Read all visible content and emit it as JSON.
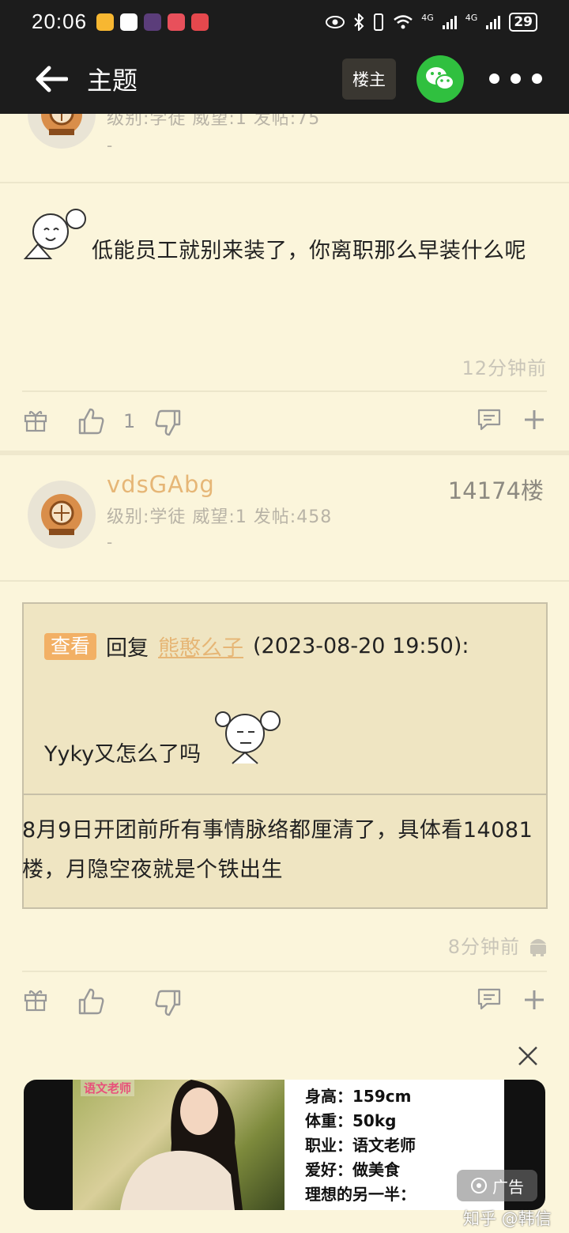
{
  "status_bar": {
    "time": "20:06",
    "signal_label_1": "4G",
    "signal_label_2": "4G",
    "battery": "29"
  },
  "title_bar": {
    "title": "主题",
    "author_only_label": "楼主"
  },
  "prev_post": {
    "meta": "级别:学徒 威望:1 发帖:75",
    "dash": "-",
    "text": "低能员工就别来装了，你离职那么早装什么呢",
    "time": "12分钟前",
    "like_count": "1"
  },
  "post": {
    "username": "vdsGAbg",
    "floor": "14174楼",
    "meta": "级别:学徒 威望:1 发帖:458",
    "dash": "-",
    "quote": {
      "tag": "查看",
      "reply_label": "回复",
      "reply_user": "熊憨么子",
      "reply_date": "(2023-08-20 19:50):",
      "text": "Yyky又怎么了吗"
    },
    "text": "8月9日开团前所有事情脉络都厘清了，具体看14081楼，月隐空夜就是个铁出生",
    "time": "8分钟前",
    "like_count": ""
  },
  "ad": {
    "image_caption": "语文老师",
    "lines": [
      "身高：159cm",
      "体重：50kg",
      "职业：语文老师",
      "爱好：做美食",
      "理想的另一半："
    ],
    "ad_label": "广告",
    "watermark": "知乎 @韩信"
  },
  "colors": {
    "accent": "#f2b065",
    "username": "#e6b676",
    "wechat": "#30c03f",
    "bg": "#fbf5db"
  }
}
